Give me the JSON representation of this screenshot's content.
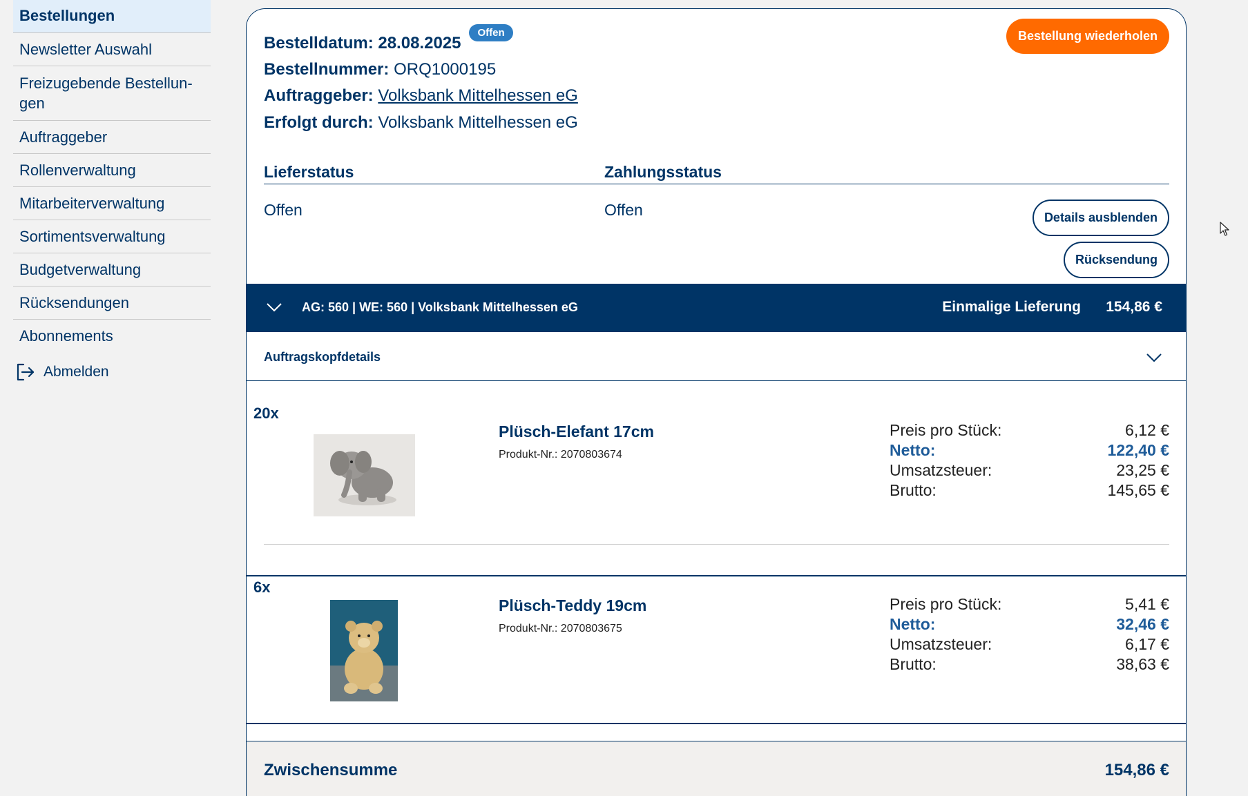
{
  "sidebar": {
    "items": [
      {
        "label": "Bestellungen",
        "active": true
      },
      {
        "label": "Newsletter Auswahl"
      },
      {
        "label": "Freizugebende Bestellun-\ngen"
      },
      {
        "label": "Auftraggeber"
      },
      {
        "label": "Rollenverwaltung"
      },
      {
        "label": "Mitarbeiterverwaltung"
      },
      {
        "label": "Sortimentsverwaltung"
      },
      {
        "label": "Budgetverwaltung"
      },
      {
        "label": "Rücksendungen"
      },
      {
        "label": "Abonnements"
      }
    ],
    "logout_label": "Abmelden"
  },
  "order": {
    "date_label": "Bestelldatum: 28.08.2025",
    "status_badge": "Offen",
    "repeat_button": "Bestellung wiederholen",
    "number_label": "Bestellnummer:",
    "number_value": "ORQ1000195",
    "client_label": "Auftraggeber:",
    "client_value": "Volksbank Mittelhessen eG",
    "by_label": "Erfolgt durch:",
    "by_value": "Volksbank Mittelhessen eG",
    "delivery_status_label": "Lieferstatus",
    "payment_status_label": "Zahlungsstatus",
    "delivery_status_value": "Offen",
    "payment_status_value": "Offen",
    "details_button": "Details ausblenden",
    "return_button": "Rücksendung"
  },
  "delivery": {
    "info": "AG: 560 | WE: 560 | Volksbank Mittelhessen eG",
    "type": "Einmalige Lieferung",
    "total": "154,86 €"
  },
  "accordion": {
    "label": "Auftragskopfdetails"
  },
  "products": [
    {
      "qty": "20x",
      "name": "Plüsch-Elefant 17cm",
      "nr": "Produkt-Nr.: 2070803674",
      "price_label": "Preis pro Stück:",
      "price": "6,12 €",
      "netto_label": "Netto:",
      "netto": "122,40 €",
      "tax_label": "Umsatzsteuer:",
      "tax": "23,25 €",
      "brutto_label": "Brutto:",
      "brutto": "145,65 €"
    },
    {
      "qty": "6x",
      "name": "Plüsch-Teddy 19cm",
      "nr": "Produkt-Nr.: 2070803675",
      "price_label": "Preis pro Stück:",
      "price": "5,41 €",
      "netto_label": "Netto:",
      "netto": "32,46 €",
      "tax_label": "Umsatzsteuer:",
      "tax": "6,17 €",
      "brutto_label": "Brutto:",
      "brutto": "38,63 €"
    }
  ],
  "subtotal": {
    "label": "Zwischensumme",
    "value": "154,86 €"
  },
  "colors": {
    "primary": "#003466",
    "accent": "#ff6a00",
    "badge": "#2e7ec4",
    "active_nav_bg": "#e1eefa"
  }
}
